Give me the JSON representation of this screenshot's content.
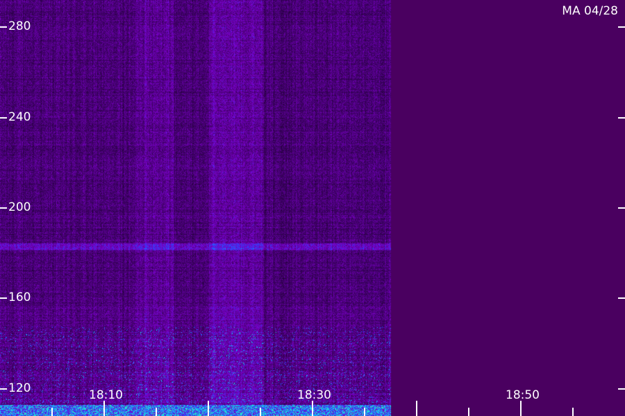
{
  "chart_data": {
    "type": "heatmap",
    "title": "MA 04/28",
    "y_ticks": [
      "120",
      "160",
      "200",
      "240",
      "280"
    ],
    "x_ticks": [
      "18:10",
      "18:30",
      "18:50"
    ],
    "ylim": [
      108,
      292
    ],
    "xlim_minutes": [
      0,
      60
    ],
    "data_end_minutes": 37.5,
    "bands": [
      {
        "feature": "horizontal-interference-line",
        "y": 183
      },
      {
        "feature": "broadband-noise-floor",
        "y_range": [
          108,
          113
        ]
      }
    ],
    "colormap": [
      "#12001d",
      "#2a0046",
      "#4b007a",
      "#7a00c8",
      "#2a44ff",
      "#10c0ff",
      "#30ffb0"
    ],
    "background_color": "#4a0060"
  }
}
